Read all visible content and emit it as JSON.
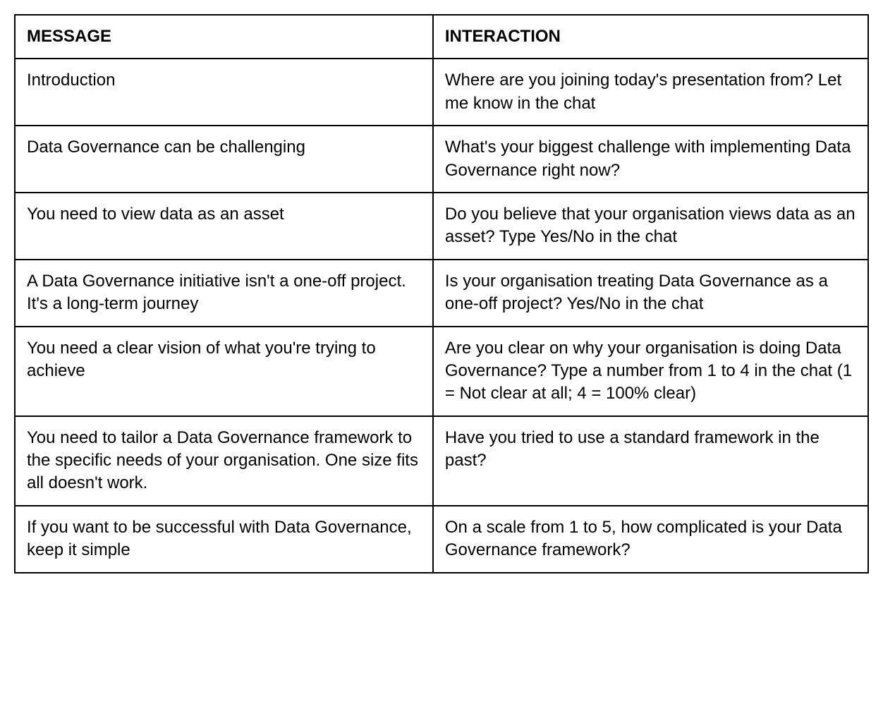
{
  "table": {
    "headers": {
      "message": "MESSAGE",
      "interaction": "INTERACTION"
    },
    "rows": [
      {
        "message": "Introduction",
        "interaction": "Where are you joining today's presentation from? Let me know in the chat"
      },
      {
        "message": "Data Governance can be challenging",
        "interaction": "What's your biggest challenge with implementing Data Governance right now?"
      },
      {
        "message": "You need to view data as an asset",
        "interaction": "Do you believe that your organisation views data as an asset? Type Yes/No in the chat"
      },
      {
        "message": "A Data Governance initiative isn't a one-off project. It's a long-term journey",
        "interaction": "Is your organisation treating Data Governance as a one-off project? Yes/No in the chat"
      },
      {
        "message": "You need a clear vision of what you're trying to achieve",
        "interaction": "Are you clear on why your organisation is doing Data Governance? Type a number from 1 to 4 in the chat (1 = Not clear at all; 4 = 100% clear)"
      },
      {
        "message": "You need to tailor a Data Governance framework to the specific needs of your organisation. One size fits all doesn't work.",
        "interaction": "Have you tried to use a standard framework in the past?"
      },
      {
        "message": "If you want to be successful with Data Governance, keep it simple",
        "interaction": "On a scale from 1 to 5, how complicated is your Data Governance framework?"
      }
    ]
  }
}
